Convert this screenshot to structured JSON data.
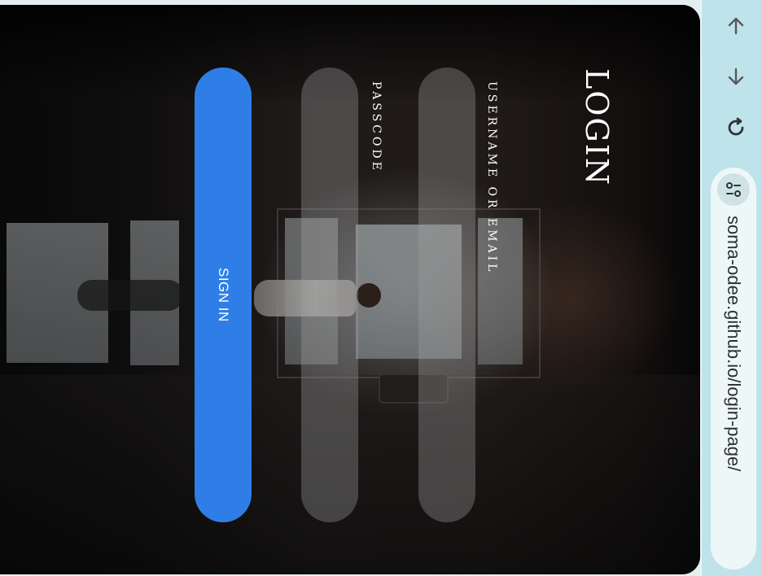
{
  "login": {
    "title": "LOGIN",
    "username_label": "USERNAME OR EMAIL",
    "username_value": "",
    "passcode_label": "PASSCODE",
    "passcode_value": "",
    "signin_label": "SIGN IN"
  },
  "browser": {
    "url": "soma-odee.github.io/login-page/",
    "icons": [
      "arrow-up-icon",
      "arrow-down-icon",
      "reload-icon",
      "site-info-icon"
    ]
  },
  "colors": {
    "accent": "#2f7ee8",
    "field_bg": "rgba(160,160,160,0.35)",
    "browser_bar": "#bfe3ea"
  }
}
